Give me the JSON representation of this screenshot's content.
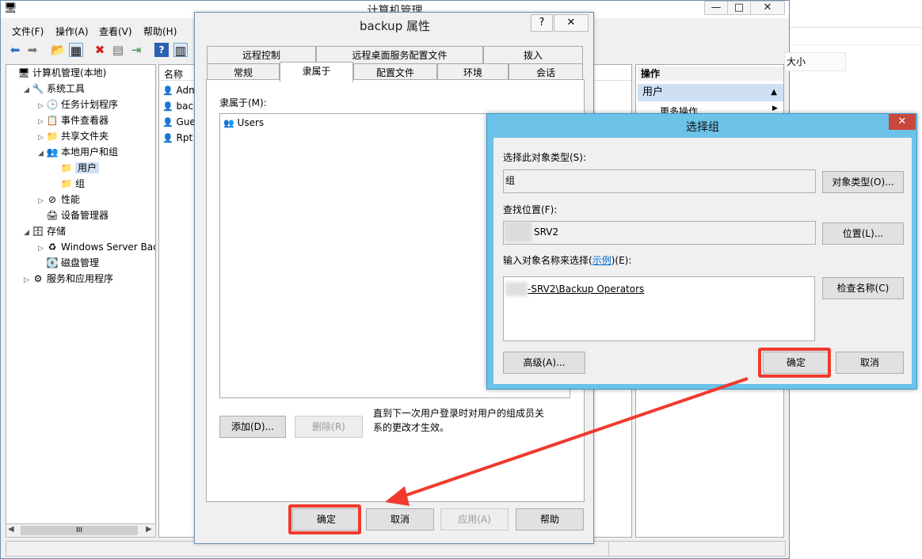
{
  "main_window": {
    "title": "计算机管理",
    "caption_buttons": [
      "—",
      "□",
      "✕"
    ],
    "menu": [
      "文件(F)",
      "操作(A)",
      "查看(V)",
      "帮助(H)"
    ],
    "toolbar_icons": [
      "back-arrow-icon",
      "forward-arrow-icon",
      "up-folder-icon",
      "show-tree-icon",
      "delete-icon",
      "properties-icon",
      "export-icon",
      "help-icon",
      "view-icon"
    ]
  },
  "tree": {
    "items": [
      {
        "label": "计算机管理(本地)",
        "level": 0,
        "icon": "🖥",
        "twisty": ""
      },
      {
        "label": "系统工具",
        "level": 1,
        "icon": "🔧",
        "twisty": "◢"
      },
      {
        "label": "任务计划程序",
        "level": 2,
        "icon": "🕒",
        "twisty": "▷"
      },
      {
        "label": "事件查看器",
        "level": 2,
        "icon": "📋",
        "twisty": "▷"
      },
      {
        "label": "共享文件夹",
        "level": 2,
        "icon": "📁",
        "twisty": "▷"
      },
      {
        "label": "本地用户和组",
        "level": 2,
        "icon": "👥",
        "twisty": "◢"
      },
      {
        "label": "用户",
        "level": 3,
        "icon": "📁",
        "twisty": "",
        "selected": true
      },
      {
        "label": "组",
        "level": 3,
        "icon": "📁",
        "twisty": ""
      },
      {
        "label": "性能",
        "level": 2,
        "icon": "⊘",
        "twisty": "▷"
      },
      {
        "label": "设备管理器",
        "level": 2,
        "icon": "🖨",
        "twisty": ""
      },
      {
        "label": "存储",
        "level": 1,
        "icon": "🗄",
        "twisty": "◢"
      },
      {
        "label": "Windows Server Back",
        "level": 2,
        "icon": "♻",
        "twisty": "▷"
      },
      {
        "label": "磁盘管理",
        "level": 2,
        "icon": "💽",
        "twisty": ""
      },
      {
        "label": "服务和应用程序",
        "level": 1,
        "icon": "⚙",
        "twisty": "▷"
      }
    ],
    "scrollbar_grip": "III"
  },
  "list": {
    "header": "名称",
    "rows": [
      "Adm",
      "bac",
      "Gue",
      "Rpt"
    ]
  },
  "actions": {
    "header": "操作",
    "section": "用户",
    "more": "更多操作"
  },
  "background": {
    "size_label": "大小"
  },
  "properties_dialog": {
    "title": "backup 属性",
    "help": "?",
    "close": "✕",
    "tabs_row1": [
      "远程控制",
      "远程桌面服务配置文件",
      "拨入"
    ],
    "tabs_row2": [
      "常规",
      "隶属于",
      "配置文件",
      "环境",
      "会话"
    ],
    "member_of_label": "隶属于(M):",
    "members": [
      "Users"
    ],
    "add_button": "添加(D)...",
    "remove_button": "删除(R)",
    "note": "直到下一次用户登录时对用户的组成员关系的更改才生效。",
    "ok": "确定",
    "cancel": "取消",
    "apply": "应用(A)",
    "help_button": "帮助"
  },
  "select_group_dialog": {
    "title": "选择组",
    "close": "✕",
    "object_type_label": "选择此对象类型(S):",
    "object_type_value": "组",
    "object_type_button": "对象类型(O)...",
    "location_label": "查找位置(F):",
    "location_value": "SRV2",
    "location_button": "位置(L)...",
    "enter_names_label_prefix": "输入对象名称来选择(",
    "example_link": "示例",
    "enter_names_label_suffix": ")(E):",
    "enter_names_value": "-SRV2\\Backup Operators",
    "check_names_button": "检查名称(C)",
    "advanced_button": "高级(A)...",
    "ok": "确定",
    "cancel": "取消"
  },
  "colors": {
    "highlight_red": "#f03a2e",
    "dialog_frame": "#6cc2e8",
    "selection": "#cfe0f5"
  }
}
